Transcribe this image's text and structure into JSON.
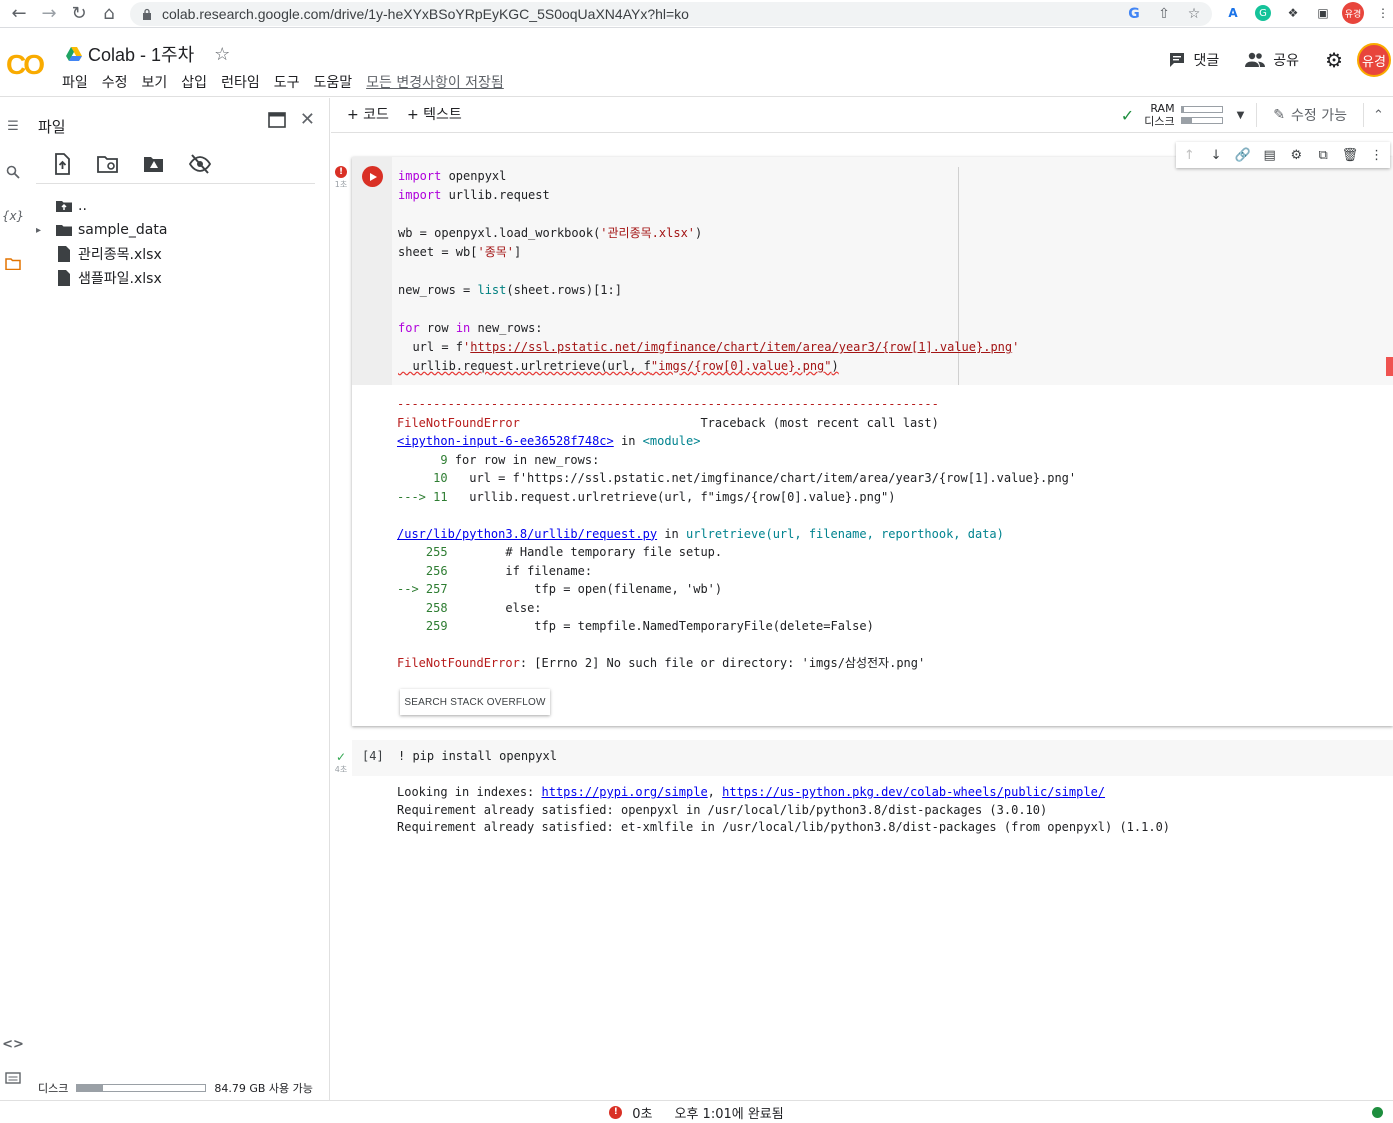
{
  "browser": {
    "url": "colab.research.google.com/drive/1y-heXYxBSoYRpEyKGC_5S0oqUaXN4AYx?hl=ko",
    "profile_initial": "유경"
  },
  "header": {
    "logo_text": "CO",
    "title": "Colab - 1주차",
    "menu": [
      "파일",
      "수정",
      "보기",
      "삽입",
      "런타임",
      "도구",
      "도움말"
    ],
    "saved_status": "모든 변경사항이 저장됨",
    "comments_label": "댓글",
    "share_label": "공유",
    "avatar_text": "유경"
  },
  "sidebar": {
    "title": "파일",
    "tree": [
      {
        "name": "..",
        "type": "parent"
      },
      {
        "name": "sample_data",
        "type": "folder"
      },
      {
        "name": "관리종목.xlsx",
        "type": "file"
      },
      {
        "name": "샘플파일.xlsx",
        "type": "file"
      }
    ],
    "disk_label": "디스크",
    "disk_available": "84.79 GB 사용 가능",
    "disk_used_fraction": 0.2
  },
  "toolbar": {
    "add_code": "+ 코드",
    "add_text": "+ 텍스트",
    "ram_label": "RAM",
    "disk_label": "디스크",
    "ram_fraction": 0.05,
    "disk_fraction": 0.25,
    "edit_label": "수정 가능"
  },
  "cell1": {
    "status_time": "1초",
    "code_lines": [
      "import openpyxl",
      "import urllib.request",
      "",
      "wb = openpyxl.load_workbook('관리종목.xlsx')",
      "sheet = wb['종목']",
      "",
      "new_rows = list(sheet.rows)[1:]",
      "",
      "for row in new_rows:",
      "  url = f'https://ssl.pstatic.net/imgfinance/chart/item/area/year3/{row[1].value}.png'",
      "  urllib.request.urlretrieve(url, f\"imgs/{row[0].value}.png\")"
    ],
    "output": {
      "dashes": "---------------------------------------------------------------------------",
      "error_name": "FileNotFoundError",
      "traceback_header": "Traceback (most recent call last)",
      "input_link": "<ipython-input-6-ee36528f748c>",
      "in_word": "in",
      "module": "<module>",
      "tb1": [
        {
          "prefix": "      ",
          "num": "9",
          "text": " for row in new_rows:"
        },
        {
          "prefix": "     ",
          "num": "10",
          "text": "   url = f'https://ssl.pstatic.net/imgfinance/chart/item/area/year3/{row[1].value}.png'"
        },
        {
          "prefix": "---> ",
          "num": "11",
          "text": "   urllib.request.urlretrieve(url, f\"imgs/{row[0].value}.png\")"
        }
      ],
      "file_link": "/usr/lib/python3.8/urllib/request.py",
      "func_sig": "urlretrieve(url, filename, reporthook, data)",
      "tb2": [
        {
          "prefix": "    ",
          "num": "255",
          "text": "        # Handle temporary file setup."
        },
        {
          "prefix": "    ",
          "num": "256",
          "text": "        if filename:"
        },
        {
          "prefix": "--> ",
          "num": "257",
          "text": "            tfp = open(filename, 'wb')"
        },
        {
          "prefix": "    ",
          "num": "258",
          "text": "        else:"
        },
        {
          "prefix": "    ",
          "num": "259",
          "text": "            tfp = tempfile.NamedTemporaryFile(delete=False)"
        }
      ],
      "final_error": "FileNotFoundError",
      "final_message": ": [Errno 2] No such file or directory: 'imgs/삼성전자.png'",
      "so_button": "SEARCH STACK OVERFLOW"
    }
  },
  "cell2": {
    "status_time": "4초",
    "exec_count": "[4]",
    "code": "! pip install openpyxl",
    "output": {
      "line1_prefix": "Looking in indexes: ",
      "link1": "https://pypi.org/simple",
      "sep": ", ",
      "link2": "https://us-python.pkg.dev/colab-wheels/public/simple/",
      "line2": "Requirement already satisfied: openpyxl in /usr/local/lib/python3.8/dist-packages (3.0.10)",
      "line3": "Requirement already satisfied: et-xmlfile in /usr/local/lib/python3.8/dist-packages (from openpyxl) (1.1.0)"
    }
  },
  "statusbar": {
    "duration": "0초",
    "completed": "오후 1:01에 완료됨"
  },
  "colors": {
    "error": "#d93025",
    "ok": "#34a853",
    "accent": "#f9ab00"
  }
}
